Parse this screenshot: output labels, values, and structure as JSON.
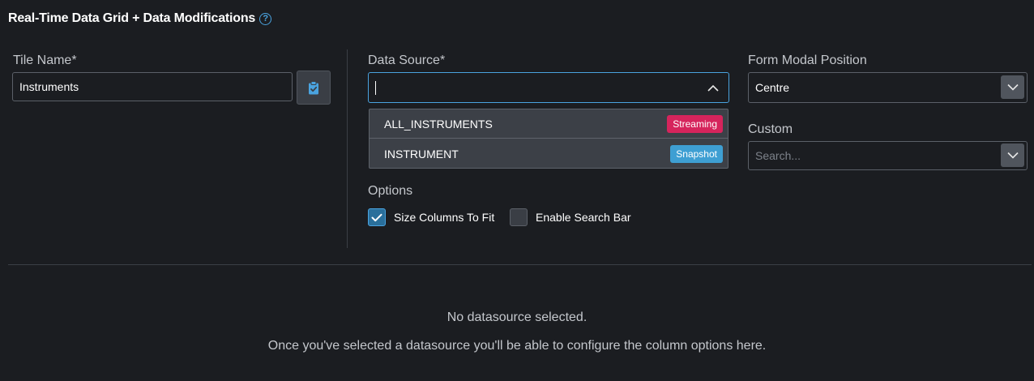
{
  "header": {
    "title": "Real-Time Data Grid + Data Modifications",
    "help_icon": "?"
  },
  "tile_name": {
    "label": "Tile Name*",
    "value": "Instruments",
    "paste_icon": "clipboard-check-icon"
  },
  "data_source": {
    "label": "Data Source*",
    "value": "",
    "open": true,
    "options": [
      {
        "label": "ALL_INSTRUMENTS",
        "badge": "Streaming",
        "badge_color": "#d6245c"
      },
      {
        "label": "INSTRUMENT",
        "badge": "Snapshot",
        "badge_color": "#3e9fd3"
      }
    ]
  },
  "form_modal_position": {
    "label": "Form Modal Position",
    "value": "Centre"
  },
  "custom": {
    "label": "Custom",
    "placeholder": "Search..."
  },
  "options": {
    "label": "Options",
    "size_columns": {
      "label": "Size Columns To Fit",
      "checked": true
    },
    "enable_search": {
      "label": "Enable Search Bar",
      "checked": false
    }
  },
  "empty_state": {
    "line1": "No datasource selected.",
    "line2": "Once you've selected a datasource you'll be able to configure the column options here."
  },
  "colors": {
    "background": "#1b1d21",
    "accent": "#4aa3df",
    "streaming": "#d6245c",
    "snapshot": "#3e9fd3"
  }
}
